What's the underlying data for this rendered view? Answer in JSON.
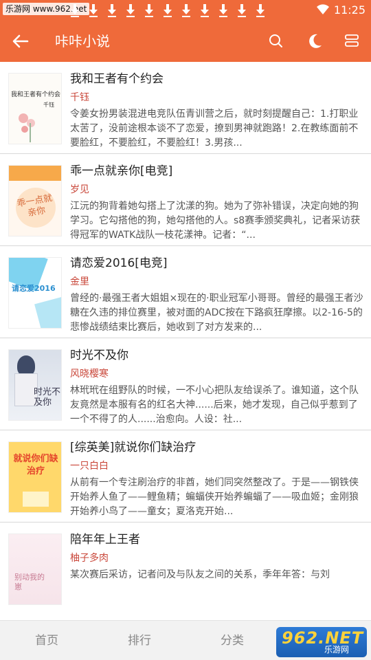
{
  "status_bar": {
    "watermark": "乐游网 www.962.net",
    "time": "11:25",
    "download_icon_count": 11
  },
  "app_bar": {
    "title": "咔咔小说",
    "back_icon": "arrow-left-icon",
    "search_icon": "search-icon",
    "night_icon": "moon-icon",
    "menu_icon": "layers-icon"
  },
  "colors": {
    "primary": "#ef6a3a",
    "author": "#c9473a"
  },
  "books": [
    {
      "title": "我和王者有个约会",
      "author": "千钰",
      "description": "令姜女扮男装混进电竞队伍青训营之后，就时刻提醒自己：1.打职业太苦了，没前途根本谈不了恋爱，撩到男神就跑路！2.在教练面前不要脸红，不要脸红，不要脸红！3.男孩...",
      "cover_text": "我和王者有个约会",
      "cover_author": "千钰"
    },
    {
      "title": "乖一点就亲你[电竞]",
      "author": "岁见",
      "description": "江沅的狗背着她勾搭上了沈漾的狗。她为了弥补错误，决定向她的狗学习。它勾搭他的狗，她勾搭他的人。s8赛季颁奖典礼，记者采访获得冠军的WATK战队一枝花漾神。记者：“...",
      "cover_text": "乖一点就亲你"
    },
    {
      "title": "请恋爱2016[电竞]",
      "author": "金里",
      "description": "曾经的·最强王者大姐姐×现在的·职业冠军小哥哥。曾经的最强王者沙糖在久违的排位赛里，被对面的ADC按在下路疯狂摩擦。以2-16-5的悲惨战绩结束比赛后，她收到了对方发来的...",
      "cover_text": "请恋爱2016"
    },
    {
      "title": "时光不及你",
      "author": "风晓樱寒",
      "description": "林玳玳在组野队的时候，一不小心把队友给误杀了。谁知道，这个队友竟然是本服有名的红名大神......后来，她才发现，自己似乎惹到了一个不得了的人......治愈向。人设：社...",
      "cover_text": "时光不及你"
    },
    {
      "title": "[综英美]就说你们缺治疗",
      "author": "一只白白",
      "description": "从前有一个专注刷治疗的非酋，她们同突然整改了。于是——钢铁侠开始养人鱼了——鲤鱼精；蝙蝠侠开始养蝙蝠了——吸血姬；金刚狼开始养小鸟了——童女；夏洛克开始...",
      "cover_text": "就说你们缺治疗"
    },
    {
      "title": "陪年年上王者",
      "author": "柚子多肉",
      "description": "某次赛后采访，记者问及与队友之间的关系，季年年答：与刘",
      "cover_text": "别动我的崽"
    }
  ],
  "bottom_nav": [
    {
      "label": "首页"
    },
    {
      "label": "排行"
    },
    {
      "label": "分类"
    }
  ],
  "watermark_br": {
    "brand": "962.NET",
    "name": "乐游网"
  }
}
